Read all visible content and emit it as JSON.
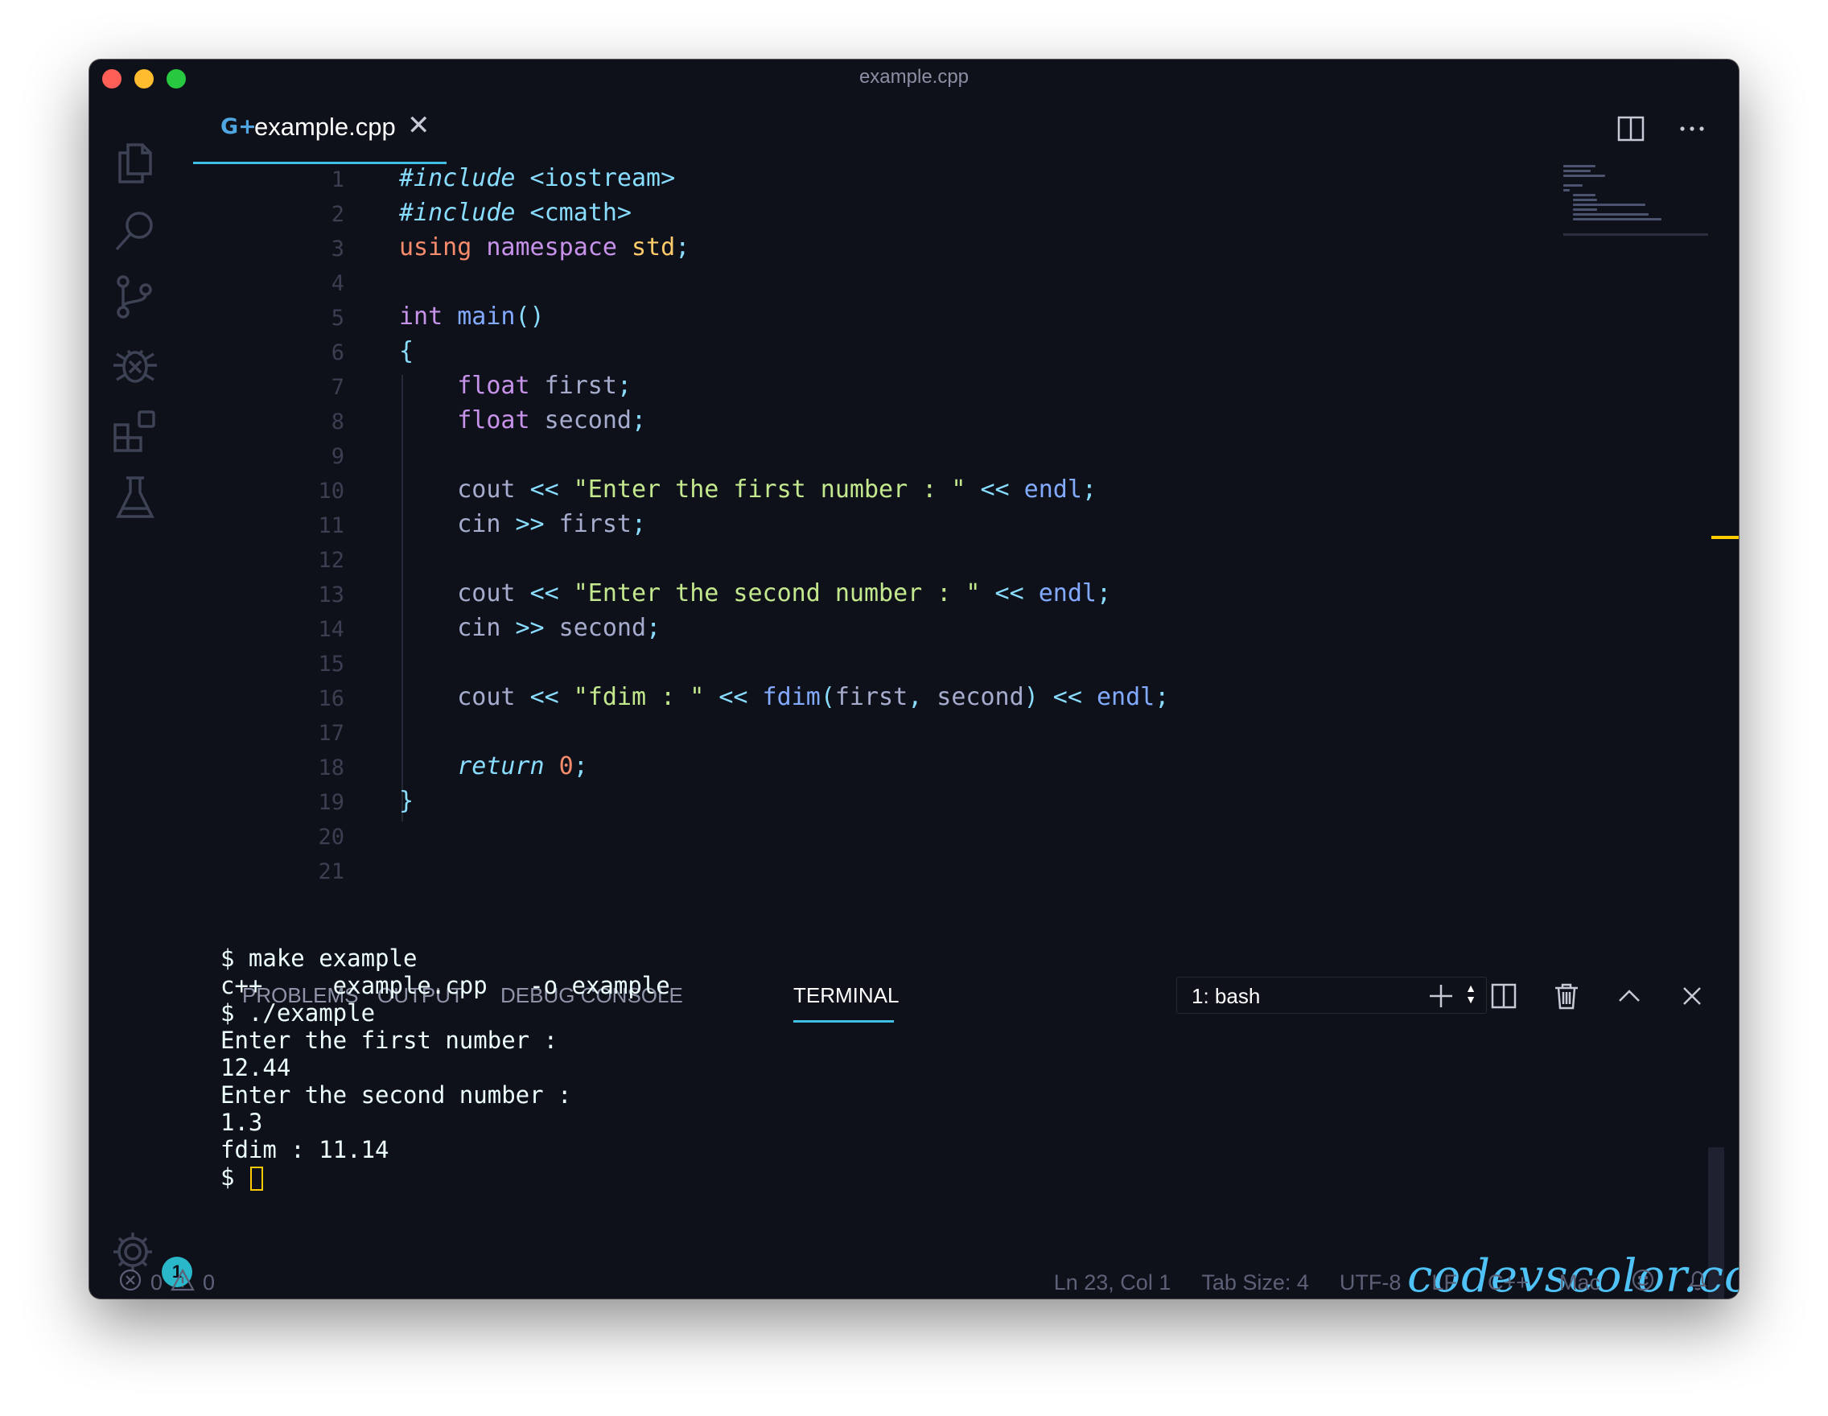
{
  "window": {
    "title": "example.cpp"
  },
  "tab": {
    "icon_glyph": "G+",
    "label": "example.cpp",
    "close_glyph": "✕"
  },
  "editor": {
    "line_numbers": [
      "1",
      "2",
      "3",
      "4",
      "5",
      "6",
      "7",
      "8",
      "9",
      "10",
      "11",
      "12",
      "13",
      "14",
      "15",
      "16",
      "17",
      "18",
      "19",
      "20",
      "21"
    ],
    "code": {
      "l1": {
        "a": "#include",
        "b": " <iostream>"
      },
      "l2": {
        "a": "#include",
        "b": " <cmath>"
      },
      "l3": {
        "a": "using",
        "b": " namespace",
        "c": " std",
        "d": ";"
      },
      "l5": {
        "a": "int",
        "b": " main",
        "c": "()"
      },
      "l6": {
        "a": "{"
      },
      "l7": {
        "a": "    float",
        "b": " first",
        "c": ";"
      },
      "l8": {
        "a": "    float",
        "b": " second",
        "c": ";"
      },
      "l10": {
        "a": "    cout ",
        "b": "<<",
        "c": " \"Enter the first number : \"",
        "d": " <<",
        "e": " endl",
        "f": ";"
      },
      "l11": {
        "a": "    cin ",
        "b": ">>",
        "c": " first",
        "d": ";"
      },
      "l13": {
        "a": "    cout ",
        "b": "<<",
        "c": " \"Enter the second number : \"",
        "d": " <<",
        "e": " endl",
        "f": ";"
      },
      "l14": {
        "a": "    cin ",
        "b": ">>",
        "c": " second",
        "d": ";"
      },
      "l16": {
        "a": "    cout ",
        "b": "<<",
        "c": " \"fdim : \"",
        "d": " <<",
        "e": " fdim",
        "f": "(",
        "g": "first",
        "h": ",",
        "i": " second",
        "j": ")",
        "k": " <<",
        "l": " endl",
        "m": ";"
      },
      "l18": {
        "a": "    return",
        "b": " 0",
        "c": ";"
      },
      "l19": {
        "a": "}"
      }
    }
  },
  "panel": {
    "tabs": [
      "PROBLEMS",
      "OUTPUT",
      "DEBUG CONSOLE",
      "TERMINAL"
    ],
    "active_tab": "TERMINAL",
    "terminal_select": "1: bash"
  },
  "terminal": {
    "lines": [
      "$ make example",
      "c++     example.cpp   -o example",
      "$ ./example",
      "Enter the first number :",
      "12.44",
      "Enter the second number :",
      "1.3",
      "fdim : 11.14"
    ],
    "prompt": "$ "
  },
  "watermark": "codevscolor.com",
  "activity": {
    "settings_badge": "1"
  },
  "statusbar": {
    "errors": "0",
    "warnings": "0",
    "position": "Ln 23, Col 1",
    "tab_size": "Tab Size: 4",
    "encoding": "UTF-8",
    "eol": "LF",
    "language": "C++",
    "platform": "Mac"
  },
  "colors": {
    "background": "#0f111a",
    "accent": "#3fc1e6",
    "string": "#c3e88d",
    "keyword": "#c792ea",
    "function": "#82aaff",
    "number": "#f78c6c",
    "cursor": "#ffcc00"
  }
}
